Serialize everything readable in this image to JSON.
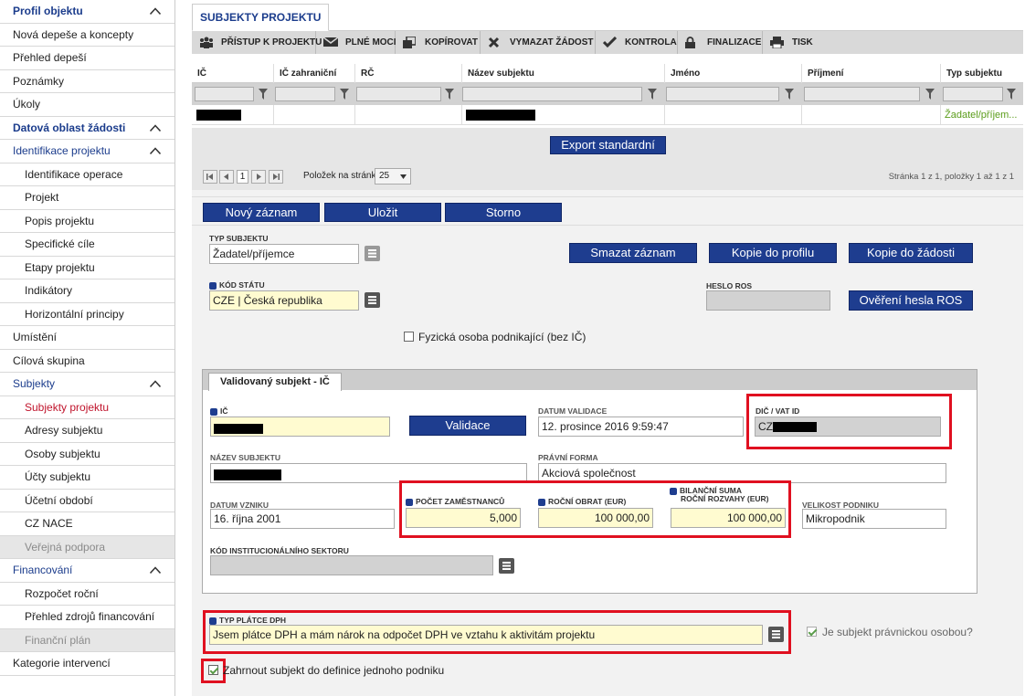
{
  "sidebar": {
    "items": [
      {
        "label": "Profil objektu",
        "kind": "section"
      },
      {
        "label": "Nová depeše a koncepty",
        "kind": "item"
      },
      {
        "label": "Přehled depeší",
        "kind": "item"
      },
      {
        "label": "Poznámky",
        "kind": "item"
      },
      {
        "label": "Úkoly",
        "kind": "item"
      },
      {
        "label": "Datová oblast žádosti",
        "kind": "section"
      },
      {
        "label": "Identifikace projektu",
        "kind": "section-blue"
      },
      {
        "label": "Identifikace operace",
        "kind": "sub"
      },
      {
        "label": "Projekt",
        "kind": "sub"
      },
      {
        "label": "Popis projektu",
        "kind": "sub"
      },
      {
        "label": "Specifické cíle",
        "kind": "sub"
      },
      {
        "label": "Etapy projektu",
        "kind": "sub"
      },
      {
        "label": "Indikátory",
        "kind": "sub"
      },
      {
        "label": "Horizontální principy",
        "kind": "sub"
      },
      {
        "label": "Umístění",
        "kind": "item"
      },
      {
        "label": "Cílová skupina",
        "kind": "item"
      },
      {
        "label": "Subjekty",
        "kind": "section-blue"
      },
      {
        "label": "Subjekty projektu",
        "kind": "sub-active"
      },
      {
        "label": "Adresy subjektu",
        "kind": "sub"
      },
      {
        "label": "Osoby subjektu",
        "kind": "sub"
      },
      {
        "label": "Účty subjektu",
        "kind": "sub"
      },
      {
        "label": "Účetní období",
        "kind": "sub"
      },
      {
        "label": "CZ NACE",
        "kind": "sub"
      },
      {
        "label": "Veřejná podpora",
        "kind": "sub-disabled"
      },
      {
        "label": "Financování",
        "kind": "section-blue"
      },
      {
        "label": "Rozpočet roční",
        "kind": "sub"
      },
      {
        "label": "Přehled zdrojů financování",
        "kind": "sub"
      },
      {
        "label": "Finanční plán",
        "kind": "sub-disabled"
      },
      {
        "label": "Kategorie intervencí",
        "kind": "item"
      }
    ]
  },
  "tab": {
    "label": "SUBJEKTY PROJEKTU"
  },
  "toolbar": {
    "access": "PŘÍSTUP K PROJEKTU",
    "power": "PLNÉ MOCI",
    "copy": "KOPÍROVAT",
    "delete": "VYMAZAT ŽÁDOST",
    "check": "KONTROLA",
    "finalize": "FINALIZACE",
    "print": "TISK"
  },
  "grid": {
    "columns": [
      "IČ",
      "IČ zahraniční",
      "RČ",
      "Název subjektu",
      "Jméno",
      "Příjmení",
      "Typ subjektu"
    ],
    "row": {
      "typ": "Žadatel/příjem..."
    }
  },
  "export_label": "Export standardní",
  "pager": {
    "page": "1",
    "per_page_label": "Položek na stránku",
    "per_page": "25",
    "info": "Stránka 1 z 1, položky 1 až 1 z 1"
  },
  "form": {
    "new": "Nový záznam",
    "save": "Uložit",
    "cancel": "Storno",
    "delete_record": "Smazat záznam",
    "copy_profile": "Kopie do profilu",
    "copy_request": "Kopie do žádosti",
    "typ_subjektu_label": "TYP SUBJEKTU",
    "typ_subjektu": "Žadatel/příjemce",
    "kod_statu_label": "KÓD STÁTU",
    "kod_statu": "CZE | Česká republika",
    "heslo_ros_label": "HESLO ROS",
    "overeni": "Ověření hesla ROS",
    "fyzicka": "Fyzická osoba podnikající (bez IČ)"
  },
  "panel": {
    "tab": "Validovaný subjekt - IČ",
    "ic_label": "IČ",
    "validace": "Validace",
    "datum_validace_label": "DATUM VALIDACE",
    "datum_validace": "12. prosince 2016 9:59:47",
    "dic_label": "DIČ / VAT ID",
    "dic": "CZ",
    "nazev_label": "NÁZEV SUBJEKTU",
    "pravni_forma_label": "PRÁVNÍ FORMA",
    "pravni_forma": "Akciová společnost",
    "datum_vzniku_label": "DATUM VZNIKU",
    "datum_vzniku": "16. října 2001",
    "pocet_label": "POČET ZAMĚSTNANCŮ",
    "pocet": "5,000",
    "obrat_label": "ROČNÍ OBRAT (EUR)",
    "obrat": "100 000,00",
    "bilancni_label": "BILANČNÍ SUMA",
    "bilancni_label2": "ROČNÍ ROZVAHY (EUR)",
    "bilancni": "100 000,00",
    "velikost_label": "VELIKOST PODNIKU",
    "velikost": "Mikropodnik",
    "kod_inst_label": "KÓD INSTITUCIONÁLNÍHO SEKTORU"
  },
  "dph": {
    "label": "TYP PLÁTCE DPH",
    "value": "Jsem plátce DPH a mám nárok na odpočet DPH ve vztahu k aktivitám projektu",
    "pravnicka": "Je subjekt právnickou osobou?",
    "zahrnout": "Zahrnout subjekt do definice jednoho podniku"
  }
}
